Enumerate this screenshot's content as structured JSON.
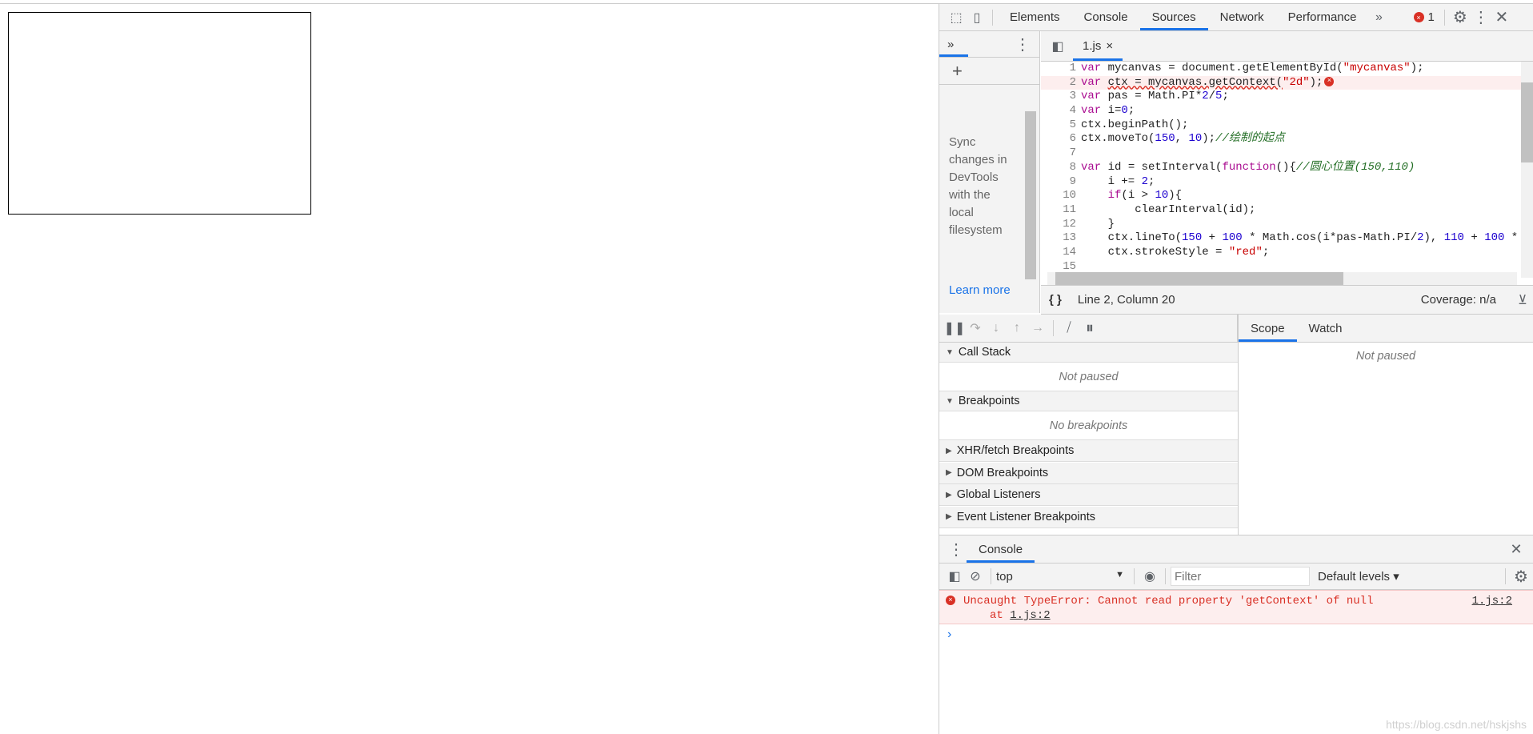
{
  "toolbar": {
    "tabs": [
      "Elements",
      "Console",
      "Sources",
      "Network",
      "Performance"
    ],
    "active": "Sources",
    "more": "»",
    "error_count": "1"
  },
  "navigator": {
    "more": "»",
    "add": "+",
    "sync_text": [
      "Sync",
      "changes in",
      "DevTools",
      "with the",
      "local",
      "filesystem"
    ],
    "learn_more": "Learn more"
  },
  "editor": {
    "file_tab": "1.js",
    "close": "×",
    "lines": [
      [
        [
          "k",
          "var "
        ],
        [
          "p",
          "mycanvas = document.getElementById("
        ],
        [
          "s",
          "\"mycanvas\""
        ],
        [
          "p",
          ");"
        ]
      ],
      [
        [
          "k",
          "var "
        ],
        [
          "p",
          "ctx = mycanvas.getContext("
        ],
        [
          "s",
          "\"2d\""
        ],
        [
          "p",
          ");"
        ]
      ],
      [
        [
          "k",
          "var "
        ],
        [
          "p",
          "pas = Math.PI*"
        ],
        [
          "n",
          "2"
        ],
        [
          "p",
          "/"
        ],
        [
          "n",
          "5"
        ],
        [
          "p",
          ";"
        ]
      ],
      [
        [
          "k",
          "var "
        ],
        [
          "p",
          "i="
        ],
        [
          "n",
          "0"
        ],
        [
          "p",
          ";"
        ]
      ],
      [
        [
          "p",
          "ctx.beginPath();"
        ]
      ],
      [
        [
          "p",
          "ctx.moveTo("
        ],
        [
          "n",
          "150"
        ],
        [
          "p",
          ", "
        ],
        [
          "n",
          "10"
        ],
        [
          "p",
          ");"
        ],
        [
          "c",
          "//绘制的起点"
        ]
      ],
      [],
      [
        [
          "k",
          "var "
        ],
        [
          "p",
          "id = setInterval("
        ],
        [
          "k",
          "function"
        ],
        [
          "p",
          "(){"
        ],
        [
          "c",
          "//圆心位置(150,110)"
        ]
      ],
      [
        [
          "p",
          "    i += "
        ],
        [
          "n",
          "2"
        ],
        [
          "p",
          ";"
        ]
      ],
      [
        [
          "p",
          "    "
        ],
        [
          "k",
          "if"
        ],
        [
          "p",
          "(i > "
        ],
        [
          "n",
          "10"
        ],
        [
          "p",
          "){"
        ]
      ],
      [
        [
          "p",
          "        clearInterval(id);"
        ]
      ],
      [
        [
          "p",
          "    }"
        ]
      ],
      [
        [
          "p",
          "    ctx.lineTo("
        ],
        [
          "n",
          "150"
        ],
        [
          "p",
          " + "
        ],
        [
          "n",
          "100"
        ],
        [
          "p",
          " * Math.cos(i*pas-Math.PI/"
        ],
        [
          "n",
          "2"
        ],
        [
          "p",
          "), "
        ],
        [
          "n",
          "110"
        ],
        [
          "p",
          " + "
        ],
        [
          "n",
          "100"
        ],
        [
          "p",
          " * "
        ]
      ],
      [
        [
          "p",
          "    ctx.strokeStyle = "
        ],
        [
          "s",
          "\"red\""
        ],
        [
          "p",
          ";"
        ]
      ],
      [],
      []
    ],
    "error_line": 2,
    "status": {
      "position": "Line 2, Column 20",
      "coverage": "Coverage: n/a"
    }
  },
  "debugger": {
    "sections": [
      {
        "title": "Call Stack",
        "open": true,
        "empty": "Not paused"
      },
      {
        "title": "Breakpoints",
        "open": true,
        "empty": "No breakpoints"
      },
      {
        "title": "XHR/fetch Breakpoints",
        "open": false
      },
      {
        "title": "DOM Breakpoints",
        "open": false
      },
      {
        "title": "Global Listeners",
        "open": false
      },
      {
        "title": "Event Listener Breakpoints",
        "open": false
      }
    ],
    "right_tabs": [
      "Scope",
      "Watch"
    ],
    "right_empty": "Not paused"
  },
  "console": {
    "tab": "Console",
    "context": "top",
    "filter_placeholder": "Filter",
    "levels": "Default levels ▾",
    "error": {
      "message": "Uncaught TypeError: Cannot read property 'getContext' of null",
      "source": "1.js:2",
      "at": "at ",
      "at_link": "1.js:2"
    },
    "prompt": "›"
  },
  "watermark": "https://blog.csdn.net/hskjshs",
  "colors": {
    "accent": "#1a73e8",
    "error": "#d93025",
    "error_bg": "#fdeeee"
  }
}
